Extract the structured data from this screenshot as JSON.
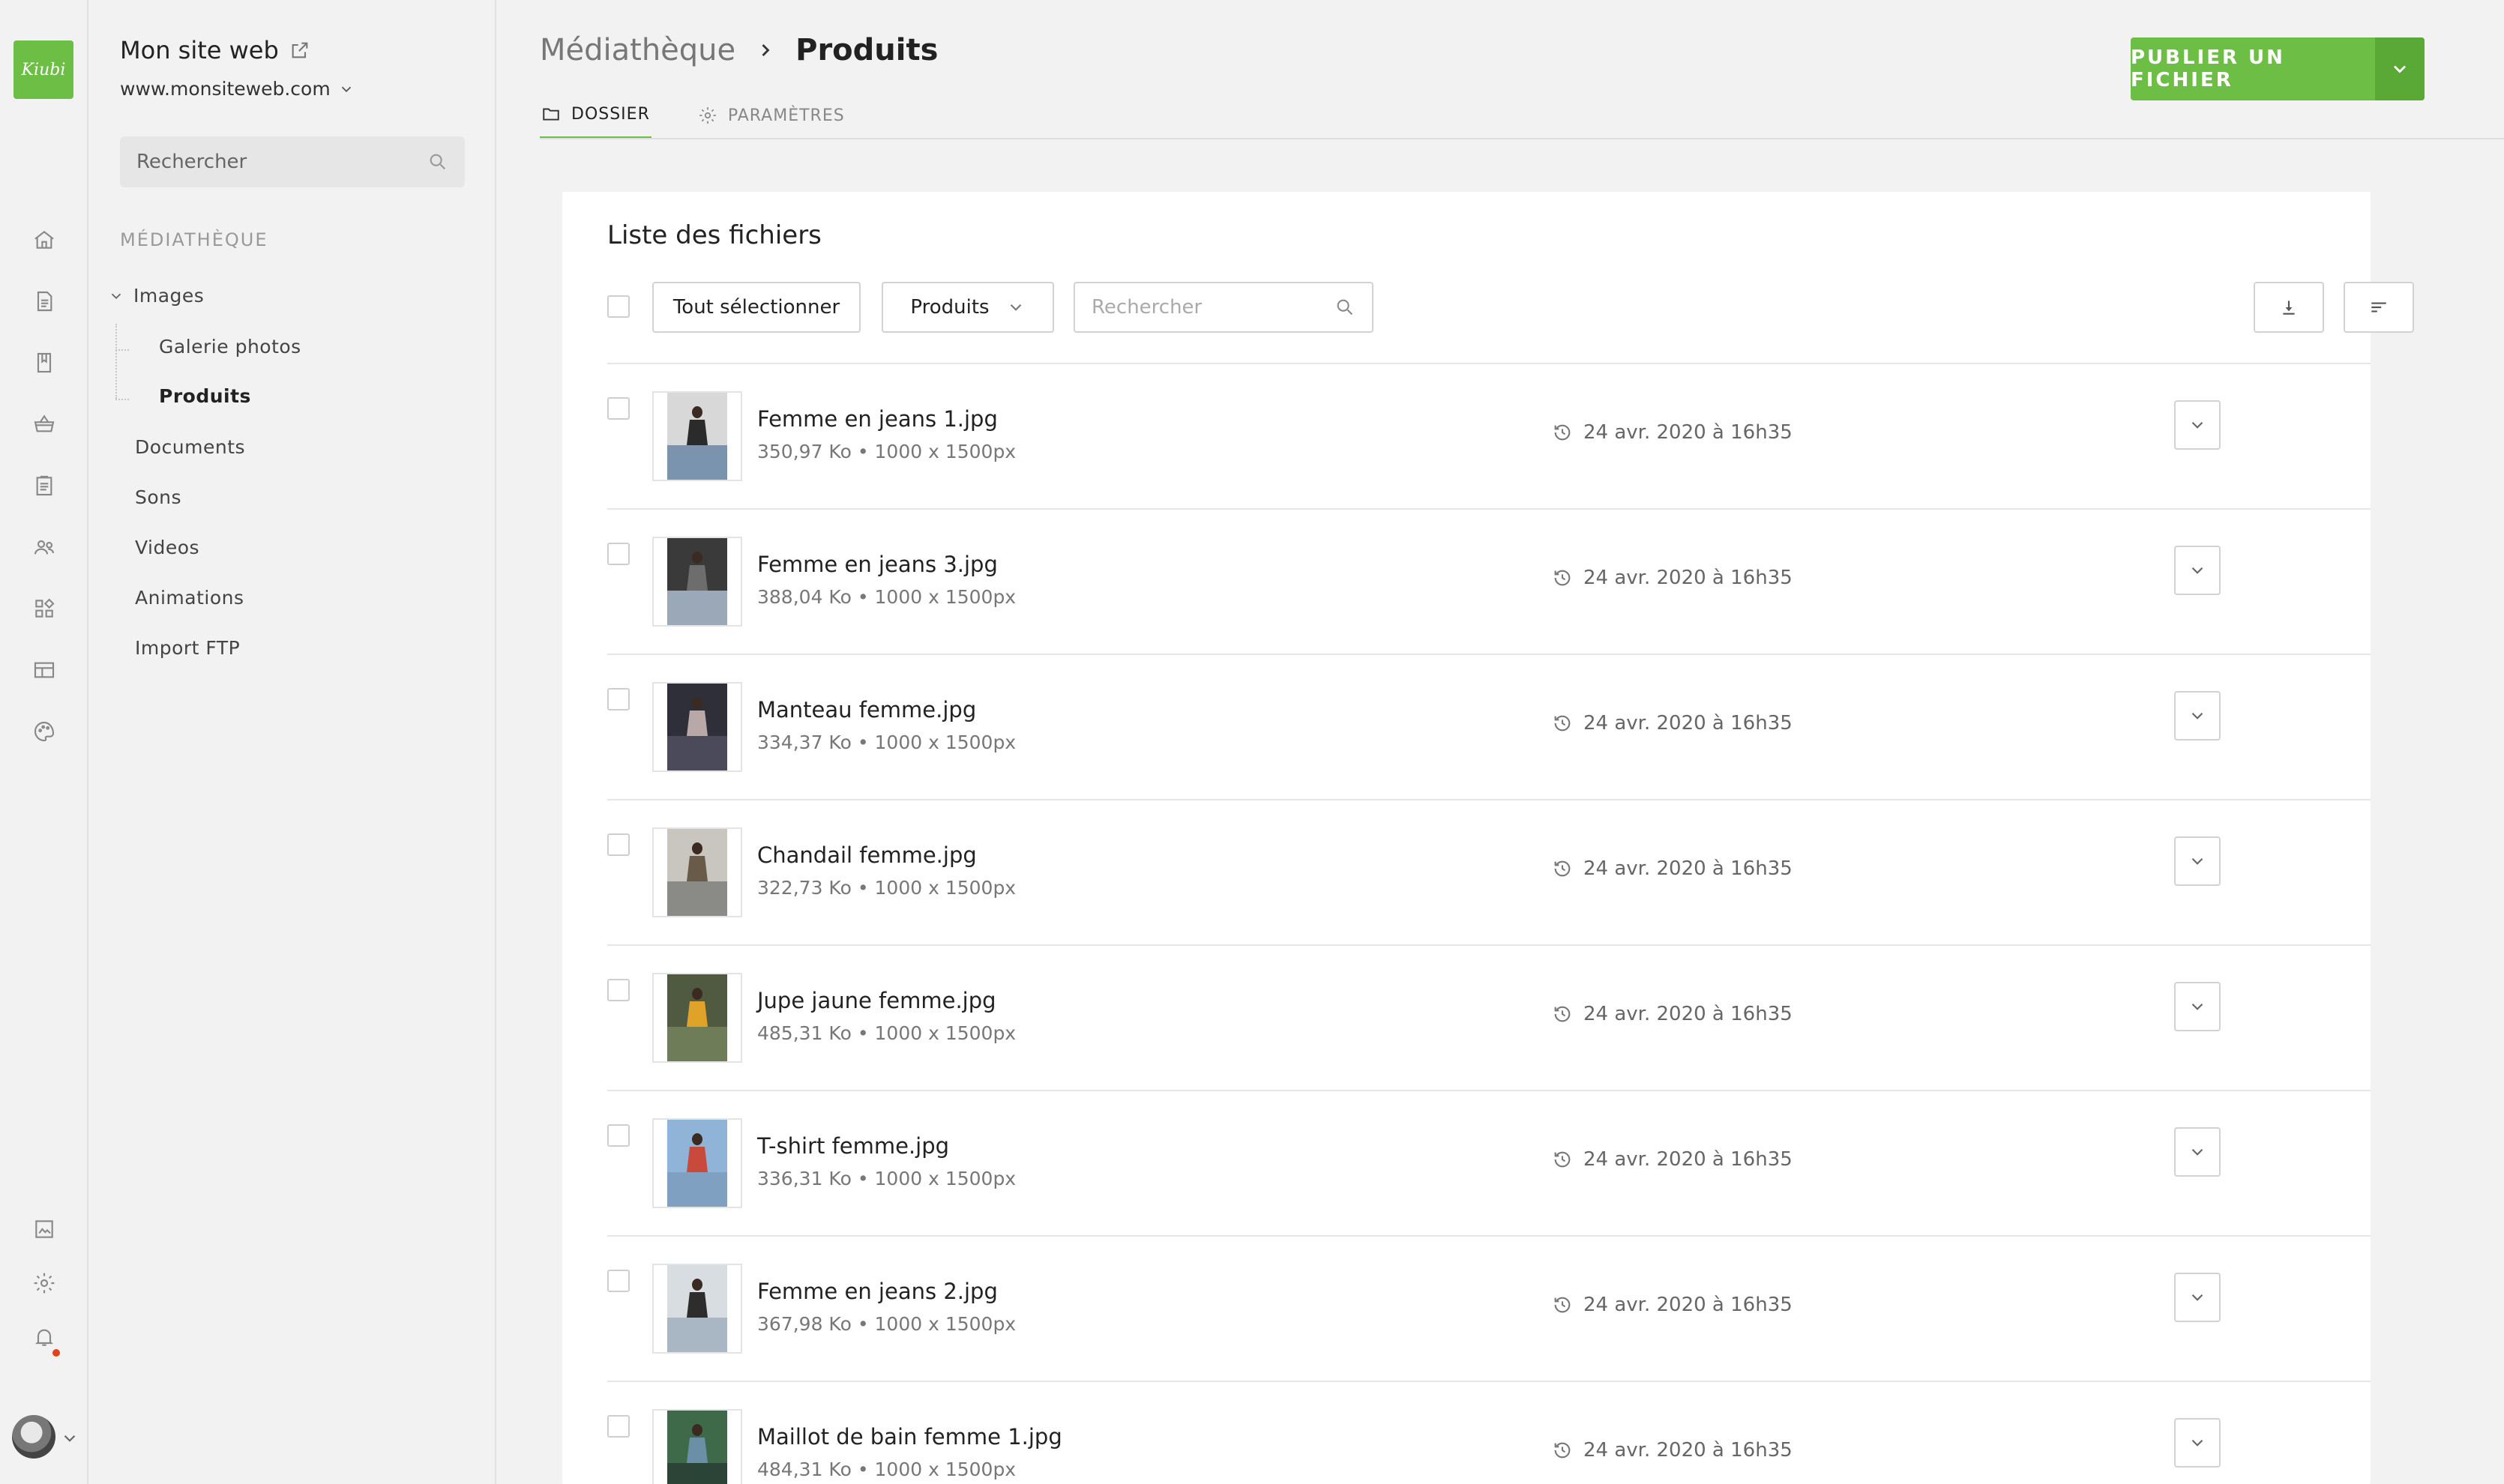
{
  "brand": {
    "logo_text": "Kiubi",
    "accent": "#6cbe45"
  },
  "site": {
    "title": "Mon site web",
    "url": "www.monsiteweb.com"
  },
  "sidebar": {
    "search_placeholder": "Rechercher",
    "section_label": "MÉDIATHÈQUE",
    "tree": {
      "images": "Images",
      "galerie": "Galerie photos",
      "produits": "Produits",
      "documents": "Documents",
      "sons": "Sons",
      "videos": "Videos",
      "animations": "Animations",
      "import_ftp": "Import FTP"
    }
  },
  "rail_icons": [
    "home-icon",
    "page-icon",
    "book-icon",
    "basket-icon",
    "clipboard-icon",
    "users-icon",
    "widgets-icon",
    "layout-icon",
    "palette-icon",
    "media-icon",
    "gear-icon",
    "bell-icon"
  ],
  "header": {
    "breadcrumb_parent": "Médiathèque",
    "breadcrumb_current": "Produits",
    "tab_folder": "DOSSIER",
    "tab_settings": "PARAMÈTRES",
    "publish_label": "PUBLIER UN FICHIER"
  },
  "panel": {
    "title": "Liste des fichiers",
    "select_all": "Tout sélectionner",
    "folder_filter": "Produits",
    "search_placeholder": "Rechercher"
  },
  "files": [
    {
      "name": "Femme en jeans 1.jpg",
      "meta": "350,97 Ko • 1000 x 1500px",
      "date": "24 avr. 2020 à 16h35",
      "thumb_colors": [
        "#d8d8d8",
        "#2b2b2b",
        "#7a94b0"
      ]
    },
    {
      "name": "Femme en jeans 3.jpg",
      "meta": "388,04 Ko • 1000 x 1500px",
      "date": "24 avr. 2020 à 16h35",
      "thumb_colors": [
        "#3a3a3a",
        "#6d6d6d",
        "#9aa8b8"
      ]
    },
    {
      "name": "Manteau femme.jpg",
      "meta": "334,37 Ko • 1000 x 1500px",
      "date": "24 avr. 2020 à 16h35",
      "thumb_colors": [
        "#2f2f3a",
        "#b9a8a8",
        "#4a4a5a"
      ]
    },
    {
      "name": "Chandail femme.jpg",
      "meta": "322,73 Ko • 1000 x 1500px",
      "date": "24 avr. 2020 à 16h35",
      "thumb_colors": [
        "#c9c6c0",
        "#6a5a48",
        "#8a8a86"
      ]
    },
    {
      "name": "Jupe jaune femme.jpg",
      "meta": "485,31 Ko • 1000 x 1500px",
      "date": "24 avr. 2020 à 16h35",
      "thumb_colors": [
        "#4f5a40",
        "#e0a32a",
        "#6e7d58"
      ]
    },
    {
      "name": "T-shirt femme.jpg",
      "meta": "336,31 Ko • 1000 x 1500px",
      "date": "24 avr. 2020 à 16h35",
      "thumb_colors": [
        "#8fb4d8",
        "#c84a3a",
        "#7fa0c0"
      ]
    },
    {
      "name": "Femme en jeans 2.jpg",
      "meta": "367,98 Ko • 1000 x 1500px",
      "date": "24 avr. 2020 à 16h35",
      "thumb_colors": [
        "#d8dde2",
        "#2d2d2d",
        "#a9b6c4"
      ]
    },
    {
      "name": "Maillot de bain femme 1.jpg",
      "meta": "484,31 Ko • 1000 x 1500px",
      "date": "24 avr. 2020 à 16h35",
      "thumb_colors": [
        "#3f6a4a",
        "#6c8fa8",
        "#2c4438"
      ]
    }
  ]
}
